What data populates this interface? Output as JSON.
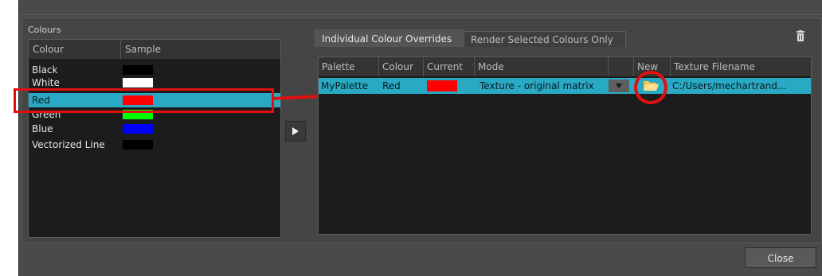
{
  "colours_group": {
    "title": "Colours",
    "headers": [
      "Colour",
      "Sample"
    ],
    "items": [
      {
        "name": "Black",
        "color": "#000000"
      },
      {
        "name": "White",
        "color": "#ffffff"
      },
      {
        "name": "Red",
        "color": "#ff0000",
        "selected": true
      },
      {
        "name": "Green",
        "color": "#00ff00"
      },
      {
        "name": "Blue",
        "color": "#0000ff"
      },
      {
        "name": "Vectorized Line",
        "color": "#000000"
      }
    ]
  },
  "tabs": [
    {
      "label": "Individual Colour Overrides",
      "active": true
    },
    {
      "label": "Render Selected Colours Only",
      "active": false
    }
  ],
  "overrides_table": {
    "headers": [
      "Palette",
      "Colour",
      "Current",
      "Mode",
      "",
      "New",
      "Texture Filename"
    ],
    "rows": [
      {
        "palette": "MyPalette",
        "colour": "Red",
        "current_color": "#ff0000",
        "mode": "Texture - original matrix",
        "texture_filename": "C:/Users/mechartrand..."
      }
    ]
  },
  "buttons": {
    "transfer_icon": "play-right-icon",
    "close_label": "Close"
  },
  "accent_colors": {
    "selection": "#2aa9c4",
    "annotation": "#e01010"
  }
}
